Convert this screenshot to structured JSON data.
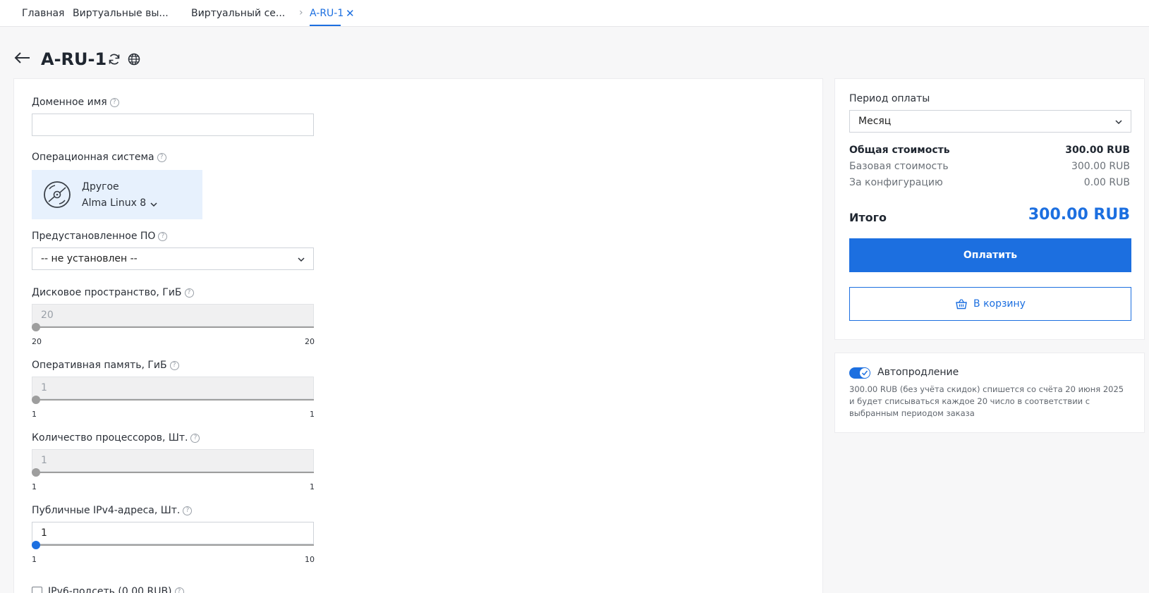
{
  "breadcrumbs": {
    "home": "Главная",
    "virtual_vps": "Виртуальные вы...",
    "virtual_server": "Виртуальный се...",
    "current": "A-RU-1"
  },
  "page": {
    "title": "A-RU-1"
  },
  "form": {
    "domain": {
      "label": "Доменное имя",
      "value": ""
    },
    "os": {
      "label": "Операционная система",
      "name": "Другое",
      "version": "Alma Linux 8"
    },
    "software": {
      "label": "Предустановленное ПО",
      "value": "-- не установлен --"
    },
    "disk": {
      "label": "Дисковое пространство, ГиБ",
      "value": "20",
      "min": "20",
      "max": "20"
    },
    "ram": {
      "label": "Оперативная память, ГиБ",
      "value": "1",
      "min": "1",
      "max": "1"
    },
    "cpu": {
      "label": "Количество процессоров, Шт.",
      "value": "1",
      "min": "1",
      "max": "1"
    },
    "ipv4": {
      "label": "Публичные IPv4-адреса, Шт.",
      "value": "1",
      "min": "1",
      "max": "10"
    },
    "ipv6": {
      "label": "IPv6-подсеть (0.00 RUB)",
      "checked": false
    }
  },
  "order": {
    "period_label": "Период оплаты",
    "period_value": "Месяц",
    "total_cost_label": "Общая стоимость",
    "total_cost_value": "300.00 RUB",
    "base_cost_label": "Базовая стоимость",
    "base_cost_value": "300.00 RUB",
    "config_cost_label": "За конфигурацию",
    "config_cost_value": "0.00 RUB",
    "grand_total_label": "Итого",
    "grand_total_value": "300.00 RUB",
    "pay_label": "Оплатить",
    "cart_label": "В корзину"
  },
  "autorenew": {
    "enabled": true,
    "label": "Автопродление",
    "description": "300.00 RUB (без учёта скидок) спишется со счёта 20 июня 2025 и будет списываться каждое 20 число в соответствии с выбранным периодом заказа"
  },
  "colors": {
    "accent": "#1c6fe0",
    "os_tile_bg": "#e7f1fd"
  },
  "icons": [
    "back-arrow-icon",
    "refresh-icon",
    "globe-icon",
    "disc-icon",
    "chevron-down-icon",
    "basket-icon",
    "check-icon",
    "close-icon",
    "help-icon"
  ]
}
